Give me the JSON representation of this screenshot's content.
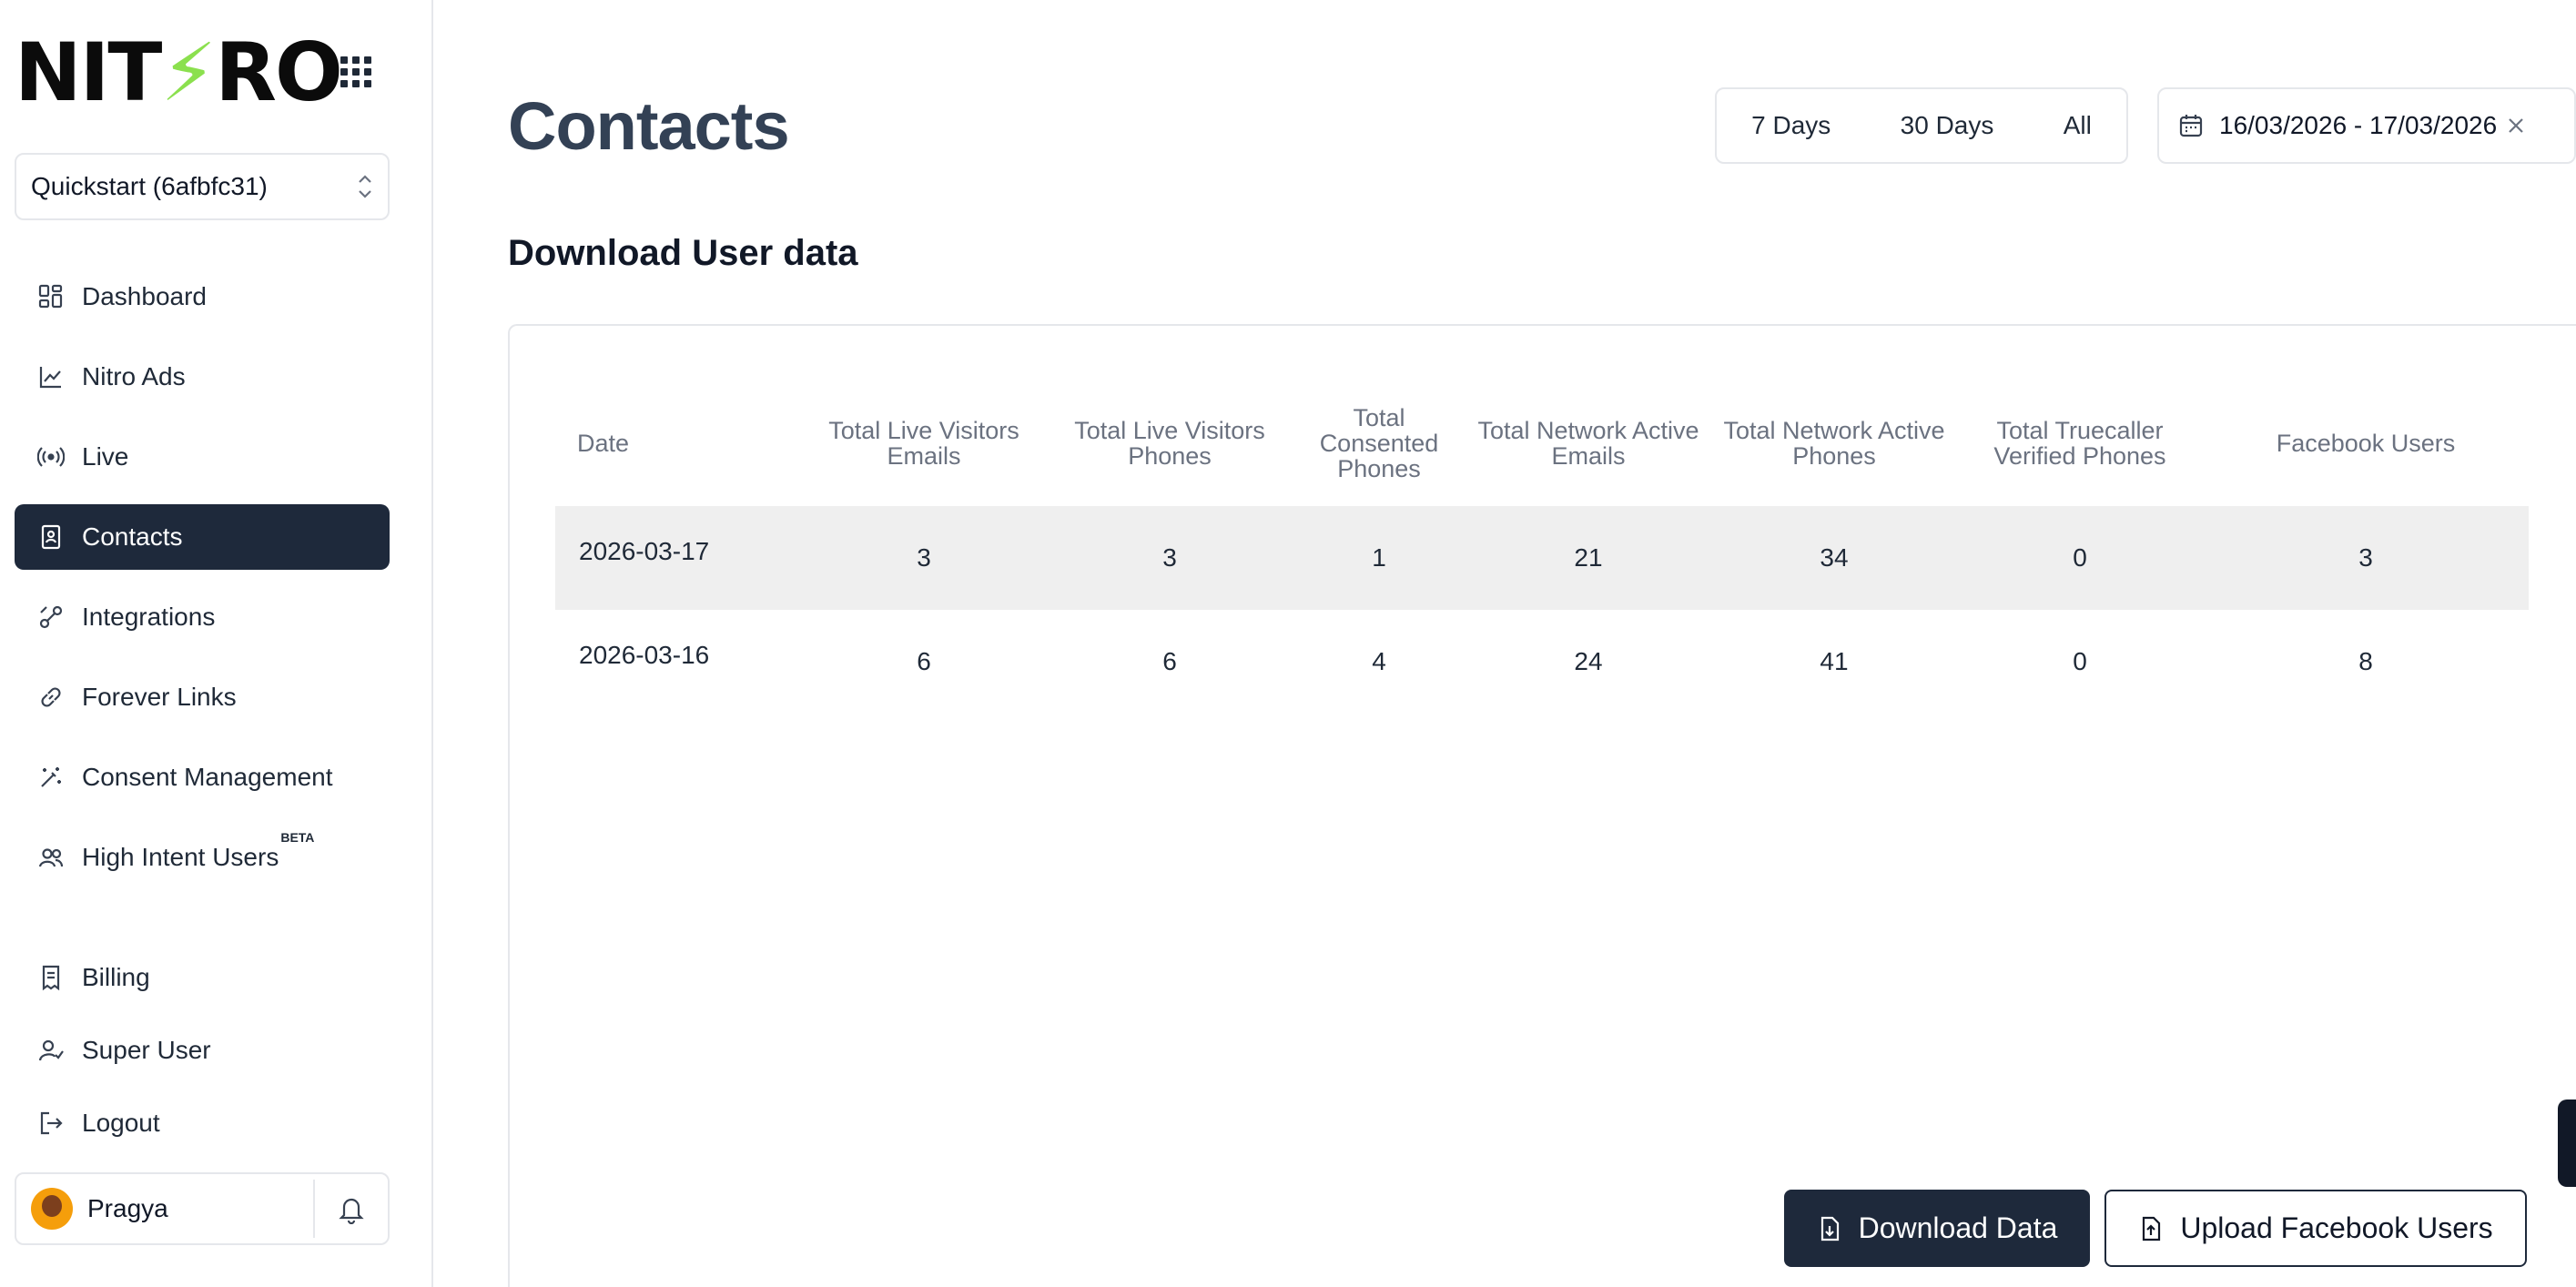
{
  "brand": {
    "logo_pre": "NIT",
    "logo_bolt": "⚡",
    "logo_post": "RO"
  },
  "workspace": {
    "label": "Quickstart (6afbfc31)"
  },
  "sidebar": {
    "items": [
      {
        "label": "Dashboard",
        "icon": "dashboard-icon"
      },
      {
        "label": "Nitro Ads",
        "icon": "chart-line-icon"
      },
      {
        "label": "Live",
        "icon": "broadcast-icon"
      },
      {
        "label": "Contacts",
        "icon": "contact-card-icon",
        "active": true
      },
      {
        "label": "Integrations",
        "icon": "plug-icon"
      },
      {
        "label": "Forever Links",
        "icon": "link-icon"
      },
      {
        "label": "Consent Management",
        "icon": "magic-wand-icon"
      },
      {
        "label": "High Intent Users",
        "icon": "users-icon",
        "badge": "BETA"
      }
    ],
    "bottom": [
      {
        "label": "Billing",
        "icon": "receipt-icon"
      },
      {
        "label": "Super User",
        "icon": "user-check-icon"
      },
      {
        "label": "Logout",
        "icon": "logout-icon"
      }
    ],
    "user": {
      "name": "Pragya"
    }
  },
  "header": {
    "title": "Contacts",
    "ranges": [
      "7 Days",
      "30 Days",
      "All"
    ],
    "date_range": "16/03/2026 - 17/03/2026"
  },
  "section": {
    "title": "Download User data"
  },
  "table": {
    "columns": [
      "Date",
      "Total Live Visitors Emails",
      "Total Live Visitors Phones",
      "Total Consented Phones",
      "Total Network Active Emails",
      "Total Network Active Phones",
      "Total Truecaller Verified Phones",
      "Facebook Users"
    ],
    "rows": [
      [
        "2026-03-17",
        "3",
        "3",
        "1",
        "21",
        "34",
        "0",
        "3"
      ],
      [
        "2026-03-16",
        "6",
        "6",
        "4",
        "24",
        "41",
        "0",
        "8"
      ]
    ]
  },
  "actions": {
    "download": "Download Data",
    "upload": "Upload Facebook Users"
  }
}
